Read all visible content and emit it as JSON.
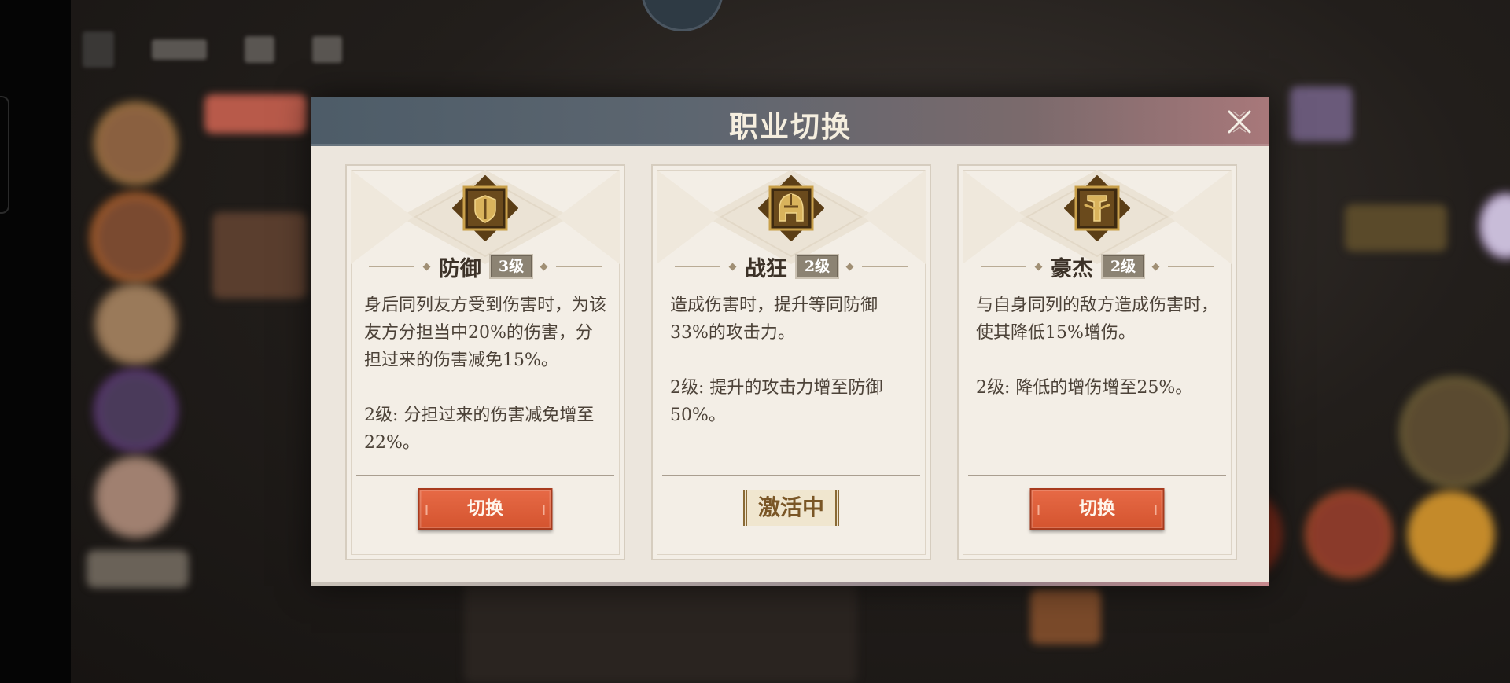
{
  "modal": {
    "title": "职业切换",
    "close_icon": "close-icon"
  },
  "cards": [
    {
      "icon": "shield-icon",
      "name": "防御",
      "level": "3级",
      "desc_main": "身后同列友方受到伤害时，为该友方分担当中20%的伤害，分担过来的伤害减免15%。",
      "desc_upgrade": "2级: 分担过来的伤害减免增至22%。",
      "action": "切换",
      "active": false
    },
    {
      "icon": "helmet-icon",
      "name": "战狂",
      "level": "2级",
      "desc_main": "造成伤害时，提升等同防御33%的攻击力。",
      "desc_upgrade": "2级: 提升的攻击力增至防御50%。",
      "action": "激活中",
      "active": true
    },
    {
      "icon": "banner-icon",
      "name": "豪杰",
      "level": "2级",
      "desc_main": "与自身同列的敌方造成伤害时，使其降低15%增伤。",
      "desc_upgrade": "2级: 降低的增伤增至25%。",
      "action": "切换",
      "active": false
    }
  ],
  "colors": {
    "switch_button": "#d9582f",
    "emblem_gold": "#c9a04a",
    "emblem_dark": "#5b3e16",
    "header_left": "#4d5c68",
    "header_right": "#a8787a"
  }
}
